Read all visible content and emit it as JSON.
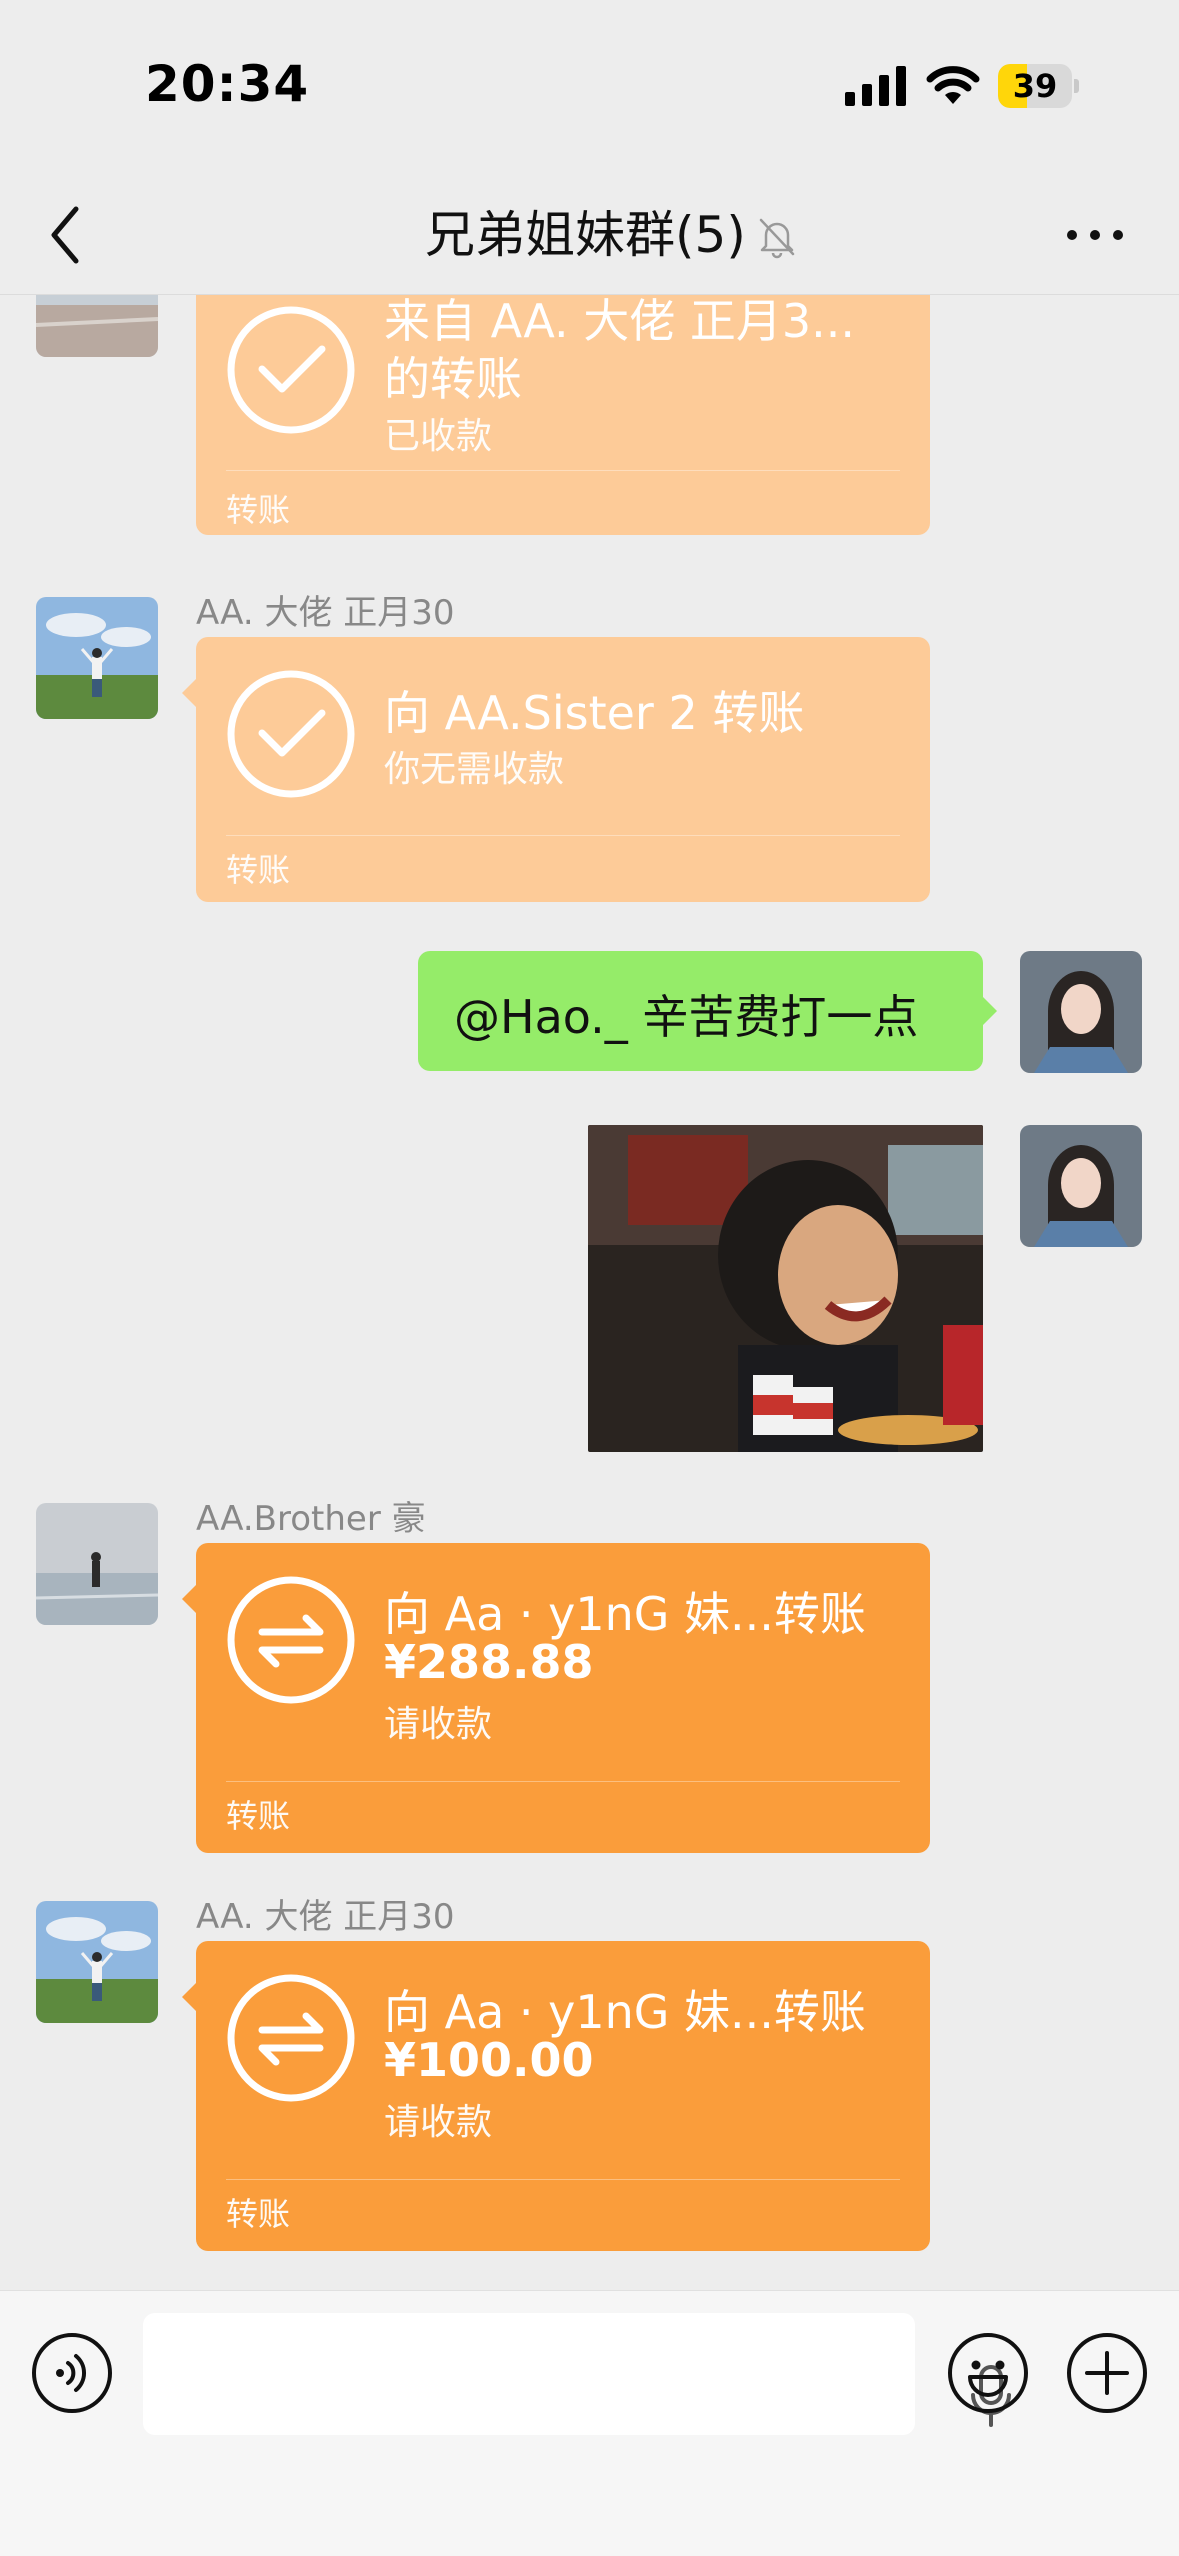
{
  "status_bar": {
    "time": "20:34",
    "battery": "39",
    "battery_level": 0.39
  },
  "nav": {
    "title": "兄弟姐妹群(5)"
  },
  "messages": {
    "m1": {
      "title_line1": "来自 AA. 大佬 正月3...",
      "title_line2": "的转账",
      "status": "已收款",
      "footer": "转账"
    },
    "m2": {
      "sender": "AA. 大佬 正月30",
      "title": "向 AA.Sister 2 转账",
      "status": "你无需收款",
      "footer": "转账"
    },
    "m3": {
      "text": "@Hao._ 辛苦费打一点"
    },
    "m5": {
      "sender": "AA.Brother 豪",
      "title": "向 Aa · y1nG 妹...转账",
      "amount": "¥288.88",
      "status": "请收款",
      "footer": "转账"
    },
    "m6": {
      "sender": "AA. 大佬 正月30",
      "title": "向 Aa · y1nG 妹...转账",
      "amount": "¥100.00",
      "status": "请收款",
      "footer": "转账"
    }
  },
  "colors": {
    "received_card": "#fdcb98",
    "pending_card": "#fa9d3b",
    "self_bubble": "#95ec69",
    "background": "#ededed"
  },
  "icons": [
    "back-icon",
    "mute-bell-icon",
    "more-icon",
    "check-circle-icon",
    "transfer-arrows-icon",
    "voice-icon",
    "mic-icon",
    "emoji-icon",
    "plus-icon"
  ]
}
